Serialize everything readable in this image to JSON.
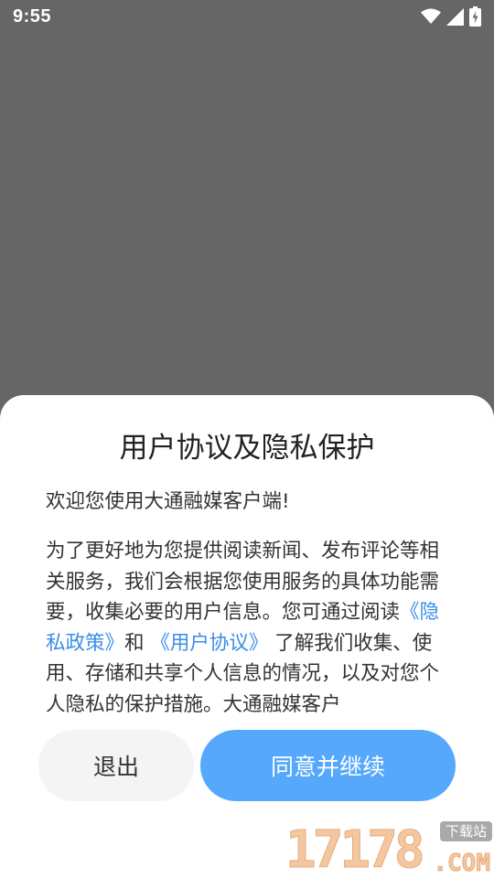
{
  "status_bar": {
    "time": "9:55",
    "icons": [
      "wifi-icon",
      "signal-icon",
      "battery-charging-icon"
    ]
  },
  "dialog": {
    "title": "用户协议及隐私保护",
    "greeting": "欢迎您使用大通融媒客户端!",
    "body_part1": "为了更好地为您提供阅读新闻、发布评论等相关服务，我们会根据您使用服务的具体功能需要，收集必要的用户信息。您可通过阅读",
    "privacy_link": "《隐私政策》",
    "and_text": "和",
    "agreement_link": " 《用户协议》",
    "body_part2": " 了解我们收集、使用、存储和共享个人信息的情况，以及对您个人隐私的保护措施。大通融媒客户",
    "exit_label": "退出",
    "agree_label": "同意并继续"
  },
  "watermark": {
    "number": "17178",
    "badge": "下载站",
    "domain": ".COM"
  },
  "colors": {
    "overlay": "#666666",
    "link": "#3a8ee6",
    "agree_button": "#55a8fb",
    "exit_button": "#f4f4f4"
  }
}
